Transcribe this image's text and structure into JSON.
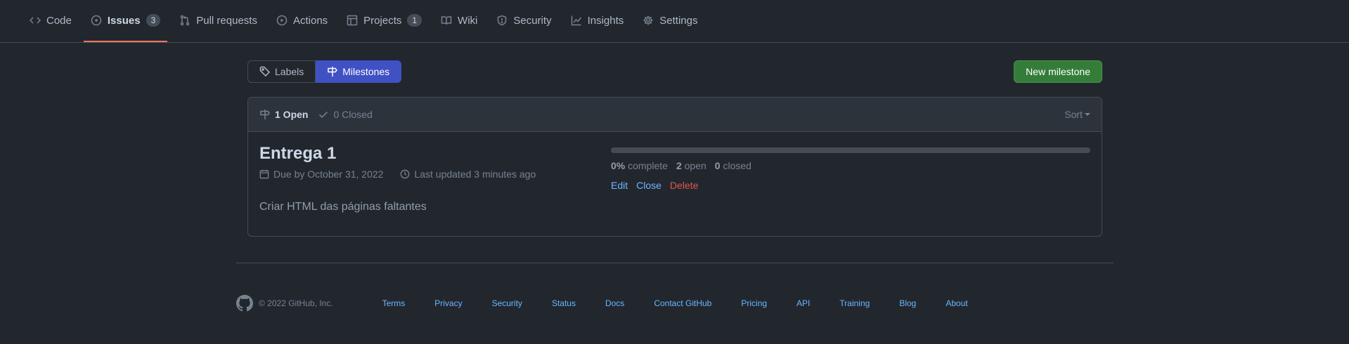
{
  "repo_nav": {
    "items": [
      {
        "label": "Code",
        "icon": "code-icon"
      },
      {
        "label": "Issues",
        "icon": "issue-opened-icon",
        "count": "3"
      },
      {
        "label": "Pull requests",
        "icon": "git-pull-request-icon"
      },
      {
        "label": "Actions",
        "icon": "play-icon"
      },
      {
        "label": "Projects",
        "icon": "table-icon",
        "count": "1"
      },
      {
        "label": "Wiki",
        "icon": "book-icon"
      },
      {
        "label": "Security",
        "icon": "shield-icon"
      },
      {
        "label": "Insights",
        "icon": "graph-icon"
      },
      {
        "label": "Settings",
        "icon": "gear-icon"
      }
    ],
    "active": "Issues",
    "active_underline_color": "#ec775c"
  },
  "subnav": {
    "labels_label": "Labels",
    "milestones_label": "Milestones",
    "selected_color": "#4051c4"
  },
  "new_milestone_label": "New milestone",
  "header": {
    "open_label": "1 Open",
    "closed_label": "0 Closed",
    "sort_label": "Sort"
  },
  "milestones": [
    {
      "title": "Entrega 1",
      "due": "Due by October 31, 2022",
      "updated": "Last updated 3 minutes ago",
      "description": "Criar HTML das páginas faltantes",
      "percent": "0%",
      "percent_label": "complete",
      "progress": 0,
      "open_count": "2",
      "open_label": "open",
      "closed_count": "0",
      "closed_label": "closed",
      "edit_label": "Edit",
      "close_label": "Close",
      "delete_label": "Delete"
    }
  ],
  "footer": {
    "copyright": "© 2022 GitHub, Inc.",
    "links": [
      "Terms",
      "Privacy",
      "Security",
      "Status",
      "Docs",
      "Contact GitHub",
      "Pricing",
      "API",
      "Training",
      "Blog",
      "About"
    ]
  },
  "colors": {
    "background": "#22272e",
    "primary_button": "#347d39",
    "link": "#6cb6ff",
    "danger": "#e5534b"
  }
}
